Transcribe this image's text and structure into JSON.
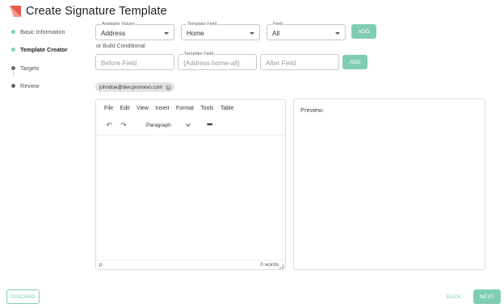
{
  "page": {
    "title": "Create Signature Template",
    "accent_color": "#80cdb5",
    "logo_color": "#e8584b"
  },
  "steps": [
    {
      "label": "Basic Information",
      "status": "complete",
      "color": "#80cdb5"
    },
    {
      "label": "Template Creator",
      "status": "active",
      "color": "#80cdb5"
    },
    {
      "label": "Targets",
      "status": "pending",
      "color": "#666666"
    },
    {
      "label": "Review",
      "status": "pending",
      "color": "#666666"
    }
  ],
  "selectors": {
    "available_values": {
      "label": "Available Values",
      "value": "Address"
    },
    "template_field": {
      "label": "Template Field",
      "value": "Home"
    },
    "field": {
      "label": "Field",
      "value": "All"
    },
    "add_label": "ADD"
  },
  "conditional": {
    "heading": "or Build Conditional",
    "before_placeholder": "Before Field",
    "template_field_label": "Template Field",
    "template_field_placeholder": "{Address-home-all}",
    "after_placeholder": "After Field",
    "add_label": "ADD"
  },
  "chip": {
    "text": "johndoe@dev.promevo.com",
    "close_glyph": "✕"
  },
  "editor": {
    "menu": [
      "File",
      "Edit",
      "View",
      "Insert",
      "Format",
      "Tools",
      "Table"
    ],
    "undo_glyph": "↶",
    "redo_glyph": "↷",
    "block_format": "Paragraph",
    "more_glyph": "•••",
    "status_path": "p",
    "word_count": "0 words"
  },
  "preview": {
    "label": "Preview:"
  },
  "footer": {
    "discard_label": "DISCARD",
    "back_label": "BACK",
    "next_label": "NEXT"
  }
}
